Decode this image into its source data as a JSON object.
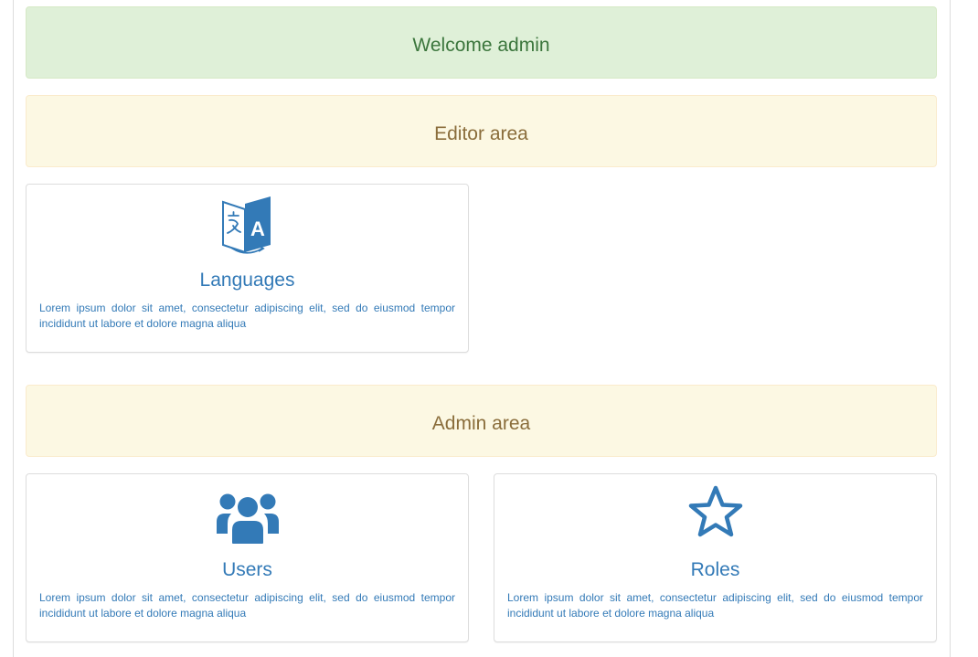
{
  "welcome": {
    "text": "Welcome admin"
  },
  "editor_section": {
    "title": "Editor area",
    "cards": [
      {
        "icon": "language-translate-icon",
        "title": "Languages",
        "description": "Lorem ipsum dolor sit amet, consectetur adipiscing elit, sed do eiusmod tempor incididunt ut labore et dolore magna aliqua"
      }
    ]
  },
  "admin_section": {
    "title": "Admin area",
    "cards": [
      {
        "icon": "users-icon",
        "title": "Users",
        "description": "Lorem ipsum dolor sit amet, consectetur adipiscing elit, sed do eiusmod tempor incididunt ut labore et dolore magna aliqua"
      },
      {
        "icon": "star-icon",
        "title": "Roles",
        "description": "Lorem ipsum dolor sit amet, consectetur adipiscing elit, sed do eiusmod tempor incididunt ut labore et dolore magna aliqua"
      }
    ]
  },
  "colors": {
    "success_bg": "#dff0d8",
    "success_text": "#3c763d",
    "warning_bg": "#fcf8e3",
    "warning_text": "#8a6d3b",
    "primary": "#337ab7"
  }
}
